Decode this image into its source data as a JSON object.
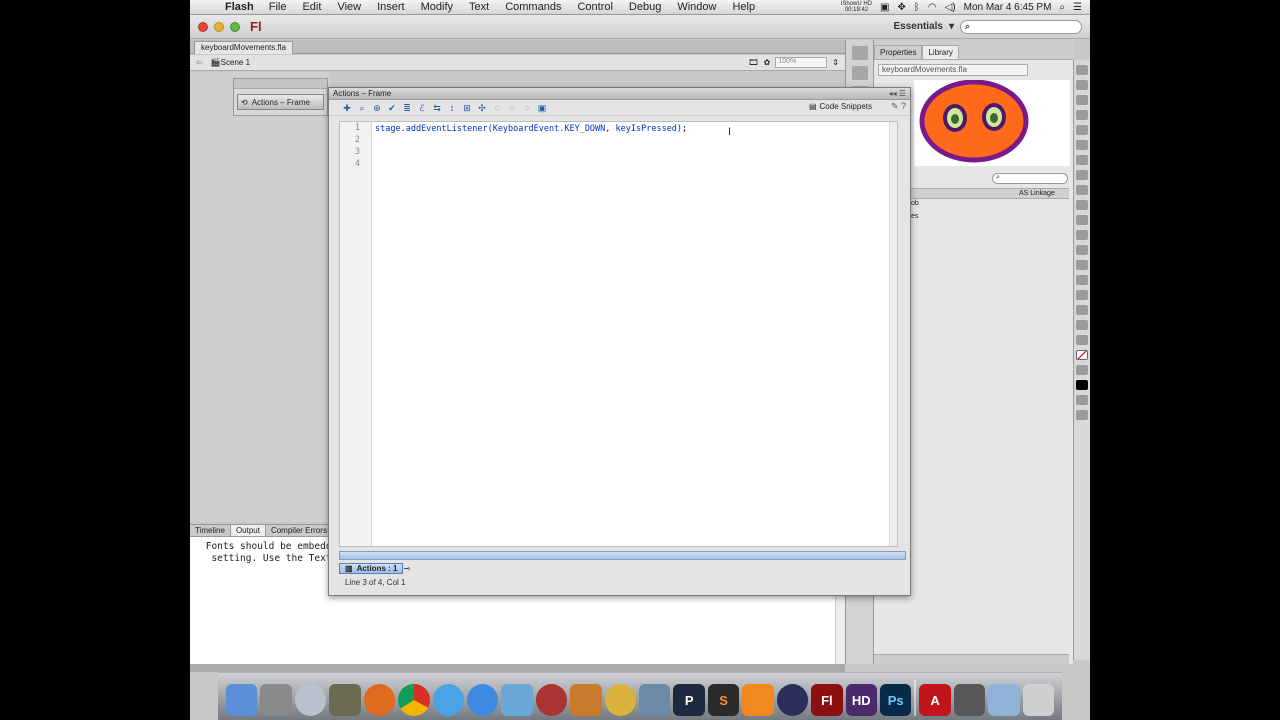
{
  "menubar": {
    "app": "Flash",
    "items": [
      "File",
      "Edit",
      "View",
      "Insert",
      "Modify",
      "Text",
      "Commands",
      "Control",
      "Debug",
      "Window",
      "Help"
    ],
    "recorder_name": "iShowU HD",
    "recorder_time": "00:19:42",
    "clock": "Mon Mar 4  6:45 PM"
  },
  "appbar": {
    "logo": "Fl",
    "workspace": "Essentials",
    "workspace_arrow": "▾"
  },
  "document": {
    "tab": "keyboardMovements.fla",
    "scene": "Scene 1",
    "zoom": "100%"
  },
  "small_panel": {
    "button_label": "Actions – Frame"
  },
  "actions": {
    "title": "Actions – Frame",
    "code_snippets_label": "Code Snippets",
    "line_numbers": [
      "1",
      "2",
      "3",
      "4"
    ],
    "code_line_1_a": "stage.addEventListener(KeyboardEvent.KEY_DOWN, keyIsPressed)",
    "code_line_1_b": ";",
    "tab_label": "Actions : 1",
    "status": "Line 3 of 4, Col 1"
  },
  "output": {
    "tabs": [
      "Timeline",
      "Output",
      "Compiler Errors"
    ],
    "text": " Fonts should be embedde\n  setting. Use the Text"
  },
  "library": {
    "tabs": [
      "Properties",
      "Library"
    ],
    "file": "keyboardMovements.fla",
    "column_linkage": "AS Linkage",
    "rows": [
      "ob",
      "es"
    ]
  },
  "dock_apps": [
    "Finder",
    "System Preferences",
    "Launchpad",
    "Photo Booth",
    "Firefox",
    "Chrome",
    "Safari",
    "iTunes",
    "Mail",
    "Photo Theater",
    "Garage Sale",
    "Ring",
    "Xcode",
    "Pinterest",
    "Sublime Text",
    "VLC",
    "Space",
    "Flash",
    "Premiere",
    "Photoshop",
    "Acrobat",
    "Downloads",
    "Applications",
    "Trash"
  ],
  "dock_letters": {
    "flash": "Fl",
    "photoshop": "Ps",
    "premiere": "HD",
    "acrobat": "A",
    "pinterest": "P",
    "sublime": "S"
  }
}
